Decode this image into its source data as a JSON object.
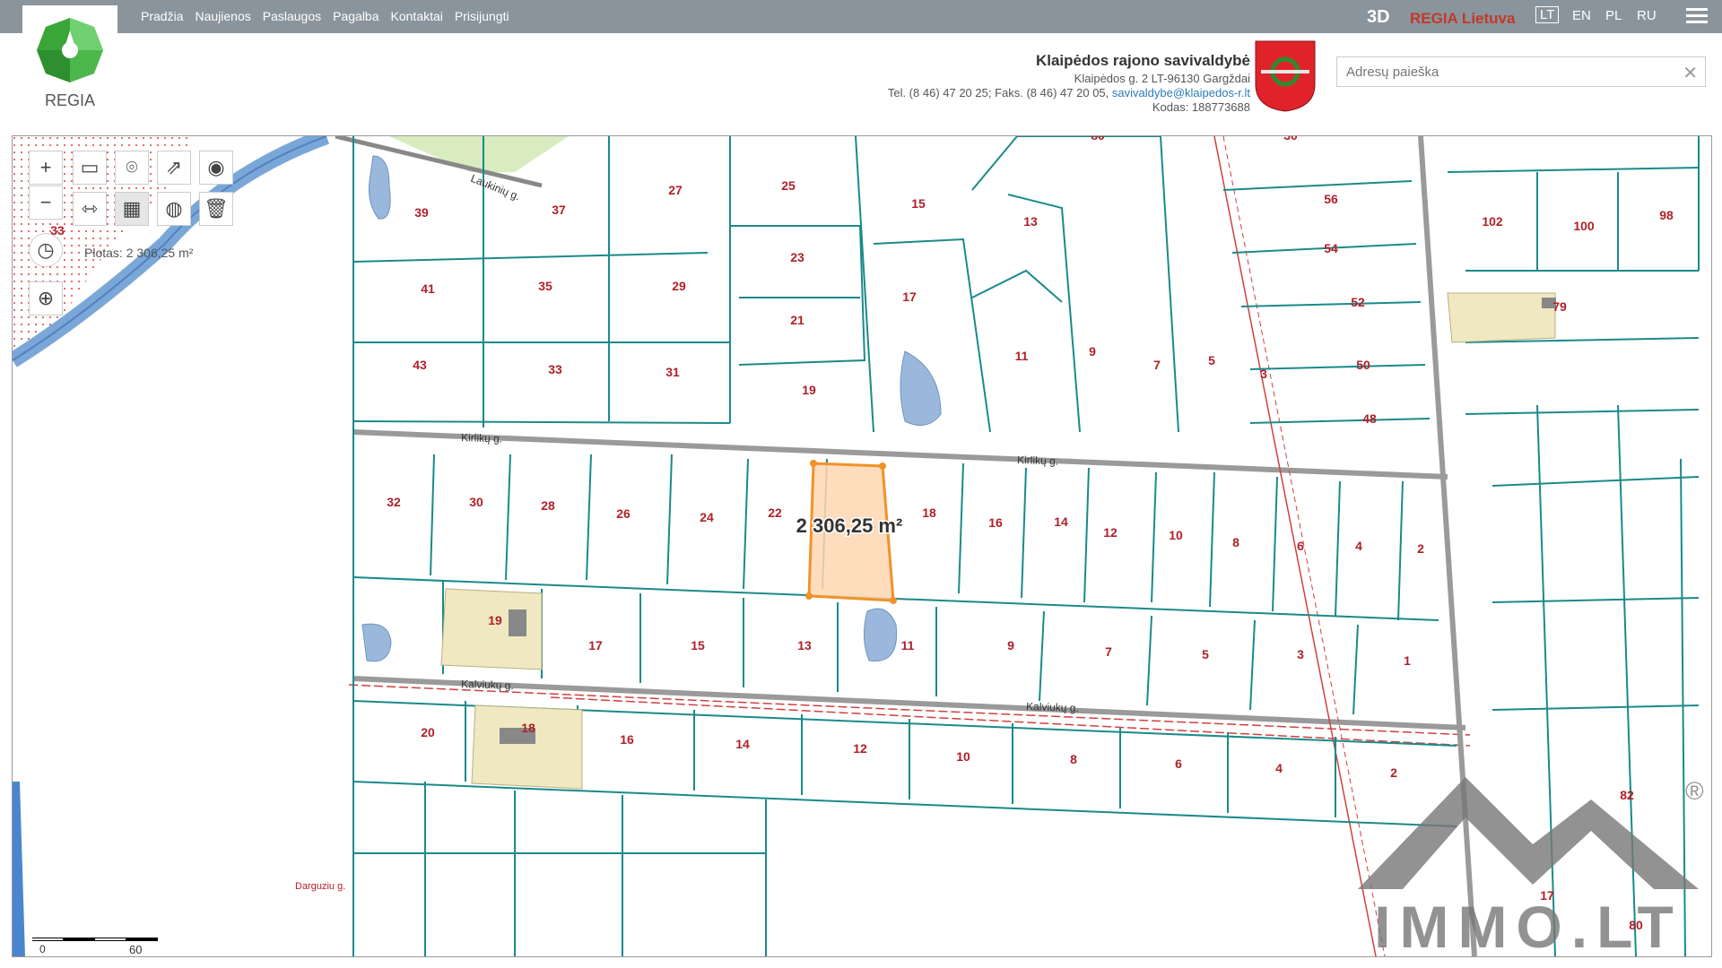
{
  "nav": [
    "Pradžia",
    "Naujienos",
    "Paslaugos",
    "Pagalba",
    "Kontaktai",
    "Prisijungti"
  ],
  "brand": {
    "logo_text": "REGIA",
    "mode_3d": "3D",
    "regia_lt": "REGIA Lietuva"
  },
  "languages": [
    "LT",
    "EN",
    "PL",
    "RU"
  ],
  "active_language": "LT",
  "municipality": {
    "name": "Klaipėdos rajono savivaldybė",
    "address": "Klaipėdos g. 2 LT-96130 Gargždai",
    "phones": "Tel. (8 46) 47 20 25; Faks. (8 46) 47 20 05, ",
    "email": "savivaldybe@klaipedos-r.lt",
    "code": "Kodas: 188773688"
  },
  "search": {
    "placeholder": "Adresų paieška",
    "value": ""
  },
  "map": {
    "area_label": "Plotas: 2 306,25 m²",
    "selected_area": "2 306,25 m²",
    "scale": {
      "zero": "0",
      "max": "60 m"
    },
    "streets": [
      "Laukinių g.",
      "Kirlikų g.",
      "Kirlikų g.",
      "Kalviukų g.",
      "Kalviukų g.",
      "Darguziu g."
    ],
    "parcels": [
      "39",
      "37",
      "27",
      "25",
      "15",
      "13",
      "56",
      "102",
      "100",
      "98",
      "41",
      "35",
      "29",
      "23",
      "17",
      "54",
      "52",
      "79",
      "43",
      "33",
      "31",
      "21",
      "19",
      "11",
      "9",
      "7",
      "5",
      "3",
      "50",
      "48",
      "32",
      "30",
      "28",
      "26",
      "24",
      "22",
      "18",
      "16",
      "14",
      "12",
      "10",
      "8",
      "6",
      "4",
      "2",
      "19",
      "17",
      "15",
      "13",
      "11",
      "9",
      "7",
      "5",
      "3",
      "1",
      "20",
      "18",
      "16",
      "14",
      "12",
      "10",
      "8",
      "6",
      "4",
      "2",
      "82",
      "80",
      "17",
      "80",
      "30",
      "33"
    ]
  },
  "watermark": "IMMO.LT",
  "colors": {
    "topbar": "#8a949c",
    "parcel_line": "#1a8a8a",
    "parcel_label": "#b0202a",
    "selected_fill": "#ffd6b0",
    "selected_stroke": "#f0922a"
  }
}
